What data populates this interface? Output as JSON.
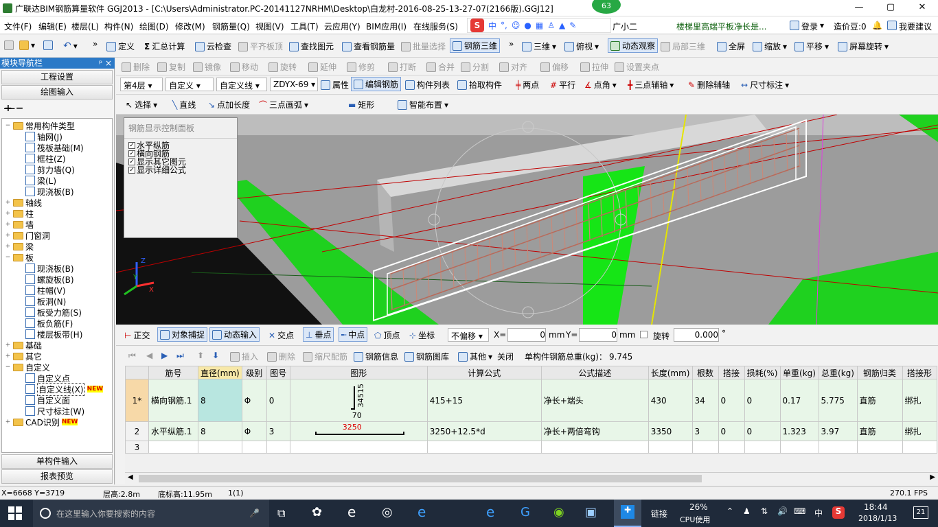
{
  "window": {
    "title": "广联达BIM钢筋算量软件 GGJ2013 - [C:\\Users\\Administrator.PC-20141127NRHM\\Desktop\\白龙村-2016-08-25-13-27-07(2166版).GGJ12]",
    "badge": "63",
    "min": "—",
    "max": "▢",
    "close": "✕"
  },
  "menu": {
    "items": [
      "文件(F)",
      "编辑(E)",
      "楼层(L)",
      "构件(N)",
      "绘图(D)",
      "修改(M)",
      "钢筋量(Q)",
      "视图(V)",
      "工具(T)",
      "云应用(Y)",
      "BIM应用(I)",
      "在线服务(S)"
    ],
    "ime": "中",
    "helper": "广小二",
    "ad": "楼梯里高端平板净长是...",
    "login": "登录",
    "price": "造价豆:0",
    "advice": "我要建议"
  },
  "toolbar1": {
    "define": "定义",
    "sum": "汇总计算",
    "cloudcheck": "云检查",
    "flat": "平齐板顶",
    "find": "查找图元",
    "viewrebar": "查看钢筋量",
    "batch": "批量选择",
    "rebar3d": "钢筋三维",
    "three_d": "三维",
    "top": "俯视",
    "dynamic": "动态观察",
    "local3d": "局部三维",
    "fullscreen": "全屏",
    "zoom": "缩放",
    "pan": "平移",
    "rotate": "屏幕旋转"
  },
  "toolbar2": {
    "items": [
      "删除",
      "复制",
      "镜像",
      "移动",
      "旋转",
      "延伸",
      "修剪",
      "打断",
      "合并",
      "分割",
      "对齐",
      "偏移",
      "拉伸",
      "设置夹点"
    ]
  },
  "toolbar3": {
    "floor": "第4层",
    "type": "自定义",
    "line": "自定义线",
    "code": "ZDYX-69",
    "props": "属性",
    "editrebar": "编辑钢筋",
    "list": "构件列表",
    "pick": "拾取构件",
    "twopoint": "两点",
    "parallel": "平行",
    "angle": "点角",
    "threeaxis": "三点辅轴",
    "delaxis": "删除辅轴",
    "dim": "尺寸标注"
  },
  "toolbar4": {
    "select": "选择",
    "line": "直线",
    "pointlen": "点加长度",
    "arc": "三点画弧",
    "rect": "矩形",
    "smart": "智能布置"
  },
  "nav": {
    "header": "模块导航栏",
    "pin": "ᵖ ×",
    "project": "工程设置",
    "drawing": "绘图输入",
    "single": "单构件输入",
    "report": "报表预览"
  },
  "tree": [
    {
      "label": "常用构件类型",
      "level": 0,
      "kind": "folder",
      "exp": "−"
    },
    {
      "label": "轴网(J)",
      "level": 1,
      "kind": "leaf"
    },
    {
      "label": "筏板基础(M)",
      "level": 1,
      "kind": "leaf"
    },
    {
      "label": "框柱(Z)",
      "level": 1,
      "kind": "leaf"
    },
    {
      "label": "剪力墙(Q)",
      "level": 1,
      "kind": "leaf"
    },
    {
      "label": "梁(L)",
      "level": 1,
      "kind": "leaf"
    },
    {
      "label": "现浇板(B)",
      "level": 1,
      "kind": "leaf"
    },
    {
      "label": "轴线",
      "level": 0,
      "kind": "folder",
      "exp": "+"
    },
    {
      "label": "柱",
      "level": 0,
      "kind": "folder",
      "exp": "+"
    },
    {
      "label": "墙",
      "level": 0,
      "kind": "folder",
      "exp": "+"
    },
    {
      "label": "门窗洞",
      "level": 0,
      "kind": "folder",
      "exp": "+"
    },
    {
      "label": "梁",
      "level": 0,
      "kind": "folder",
      "exp": "+"
    },
    {
      "label": "板",
      "level": 0,
      "kind": "folder",
      "exp": "−"
    },
    {
      "label": "现浇板(B)",
      "level": 1,
      "kind": "leaf"
    },
    {
      "label": "螺旋板(B)",
      "level": 1,
      "kind": "leaf"
    },
    {
      "label": "柱帽(V)",
      "level": 1,
      "kind": "leaf"
    },
    {
      "label": "板洞(N)",
      "level": 1,
      "kind": "leaf"
    },
    {
      "label": "板受力筋(S)",
      "level": 1,
      "kind": "leaf"
    },
    {
      "label": "板负筋(F)",
      "level": 1,
      "kind": "leaf"
    },
    {
      "label": "楼层板带(H)",
      "level": 1,
      "kind": "leaf"
    },
    {
      "label": "基础",
      "level": 0,
      "kind": "folder",
      "exp": "+"
    },
    {
      "label": "其它",
      "level": 0,
      "kind": "folder",
      "exp": "+"
    },
    {
      "label": "自定义",
      "level": 0,
      "kind": "folder",
      "exp": "−"
    },
    {
      "label": "自定义点",
      "level": 1,
      "kind": "leaf"
    },
    {
      "label": "自定义线(X)",
      "level": 1,
      "kind": "leaf",
      "selected": true
    },
    {
      "label": "自定义面",
      "level": 1,
      "kind": "leaf"
    },
    {
      "label": "尺寸标注(W)",
      "level": 1,
      "kind": "leaf"
    },
    {
      "label": "CAD识别",
      "level": 0,
      "kind": "folder",
      "exp": "+"
    }
  ],
  "newtag": "NEW",
  "panel": {
    "title": "钢筋显示控制面板",
    "checks": [
      "水平纵筋",
      "横向钢筋",
      "显示其它图元",
      "显示详细公式"
    ]
  },
  "snapbar": {
    "ortho": "正交",
    "snap": "对象捕捉",
    "dyninput": "动态输入",
    "intersect": "交点",
    "perp": "垂点",
    "mid": "中点",
    "vertex": "顶点",
    "coord": "坐标",
    "offset": "不偏移",
    "xlabel": "X=",
    "xval": "0",
    "ylabel": "Y=",
    "yval": "0",
    "unit": "mm",
    "rotate": "旋转",
    "rotval": "0.000",
    "deg": "°"
  },
  "gridbar": {
    "insert": "插入",
    "delete": "删除",
    "scale": "缩尺配筋",
    "info": "钢筋信息",
    "lib": "钢筋图库",
    "other": "其他",
    "close": "关闭",
    "total_label": "单构件钢筋总重(kg)：",
    "total": "9.745"
  },
  "table": {
    "headers": [
      "",
      "筋号",
      "直径(mm)",
      "级别",
      "图号",
      "图形",
      "计算公式",
      "公式描述",
      "长度(mm)",
      "根数",
      "搭接",
      "损耗(%)",
      "单重(kg)",
      "总重(kg)",
      "钢筋归类",
      "搭接形"
    ],
    "rows": [
      {
        "idx": "1*",
        "name": "横向钢筋.1",
        "dia": "8",
        "grade": "Φ",
        "fig": "0",
        "shape_a": "34515",
        "shape_b": "70",
        "formula": "415+15",
        "desc": "净长+端头",
        "len": "430",
        "count": "34",
        "lap": "0",
        "loss": "0",
        "unit": "0.17",
        "total": "5.775",
        "cat": "直筋",
        "laptype": "绑扎"
      },
      {
        "idx": "2",
        "name": "水平纵筋.1",
        "dia": "8",
        "grade": "Φ",
        "fig": "3",
        "shape_a": "3250",
        "shape_b": "",
        "formula": "3250+12.5*d",
        "desc": "净长+两倍弯钩",
        "len": "3350",
        "count": "3",
        "lap": "0",
        "loss": "0",
        "unit": "1.323",
        "total": "3.97",
        "cat": "直筋",
        "laptype": "绑扎"
      },
      {
        "idx": "3",
        "name": "",
        "dia": "",
        "grade": "",
        "fig": "",
        "shape_a": "",
        "shape_b": "",
        "formula": "",
        "desc": "",
        "len": "",
        "count": "",
        "lap": "",
        "loss": "",
        "unit": "",
        "total": "",
        "cat": "",
        "laptype": ""
      }
    ]
  },
  "status": {
    "coord": "X=6668 Y=3719",
    "floorh": "层高:2.8m",
    "baseh": "底标高:11.95m",
    "count": "1(1)",
    "fps": "270.1 FPS"
  },
  "taskbar": {
    "search": "在这里输入你要搜索的内容",
    "link": "链接",
    "cpu": "26%",
    "cpulabel": "CPU使用",
    "ime": "中",
    "time": "18:44",
    "date": "2018/1/13",
    "notif": "21"
  },
  "axis": {
    "x": "X",
    "y": "Y",
    "z": "Z"
  }
}
